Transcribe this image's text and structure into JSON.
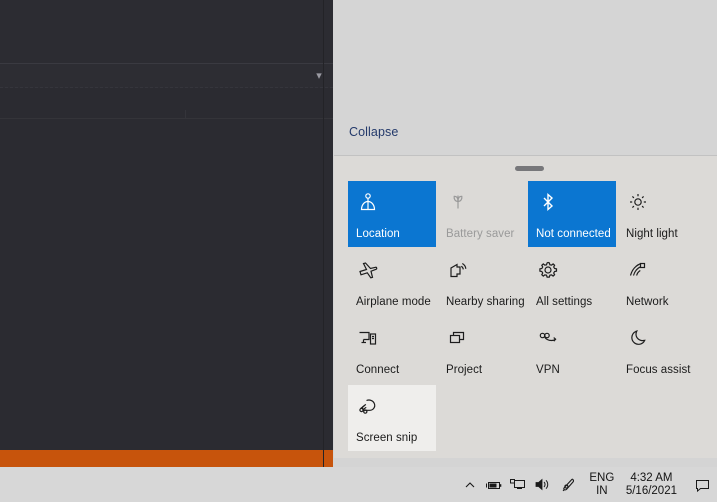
{
  "action_center": {
    "collapse_label": "Collapse",
    "handle_name": "resize-handle",
    "tiles": [
      {
        "label": "Location",
        "icon": "location-icon",
        "state": "on"
      },
      {
        "label": "Battery saver",
        "icon": "battery-saver-icon",
        "state": "disabled"
      },
      {
        "label": "Not connected",
        "icon": "bluetooth-icon",
        "state": "on"
      },
      {
        "label": "Night light",
        "icon": "night-light-icon",
        "state": "off"
      },
      {
        "label": "Airplane mode",
        "icon": "airplane-icon",
        "state": "off"
      },
      {
        "label": "Nearby sharing",
        "icon": "nearby-sharing-icon",
        "state": "off"
      },
      {
        "label": "All settings",
        "icon": "gear-icon",
        "state": "off"
      },
      {
        "label": "Network",
        "icon": "network-wifi-icon",
        "state": "off"
      },
      {
        "label": "Connect",
        "icon": "connect-icon",
        "state": "off"
      },
      {
        "label": "Project",
        "icon": "project-icon",
        "state": "off"
      },
      {
        "label": "VPN",
        "icon": "vpn-icon",
        "state": "off"
      },
      {
        "label": "Focus assist",
        "icon": "moon-icon",
        "state": "off"
      },
      {
        "label": "Screen snip",
        "icon": "screen-snip-icon",
        "state": "hover"
      }
    ]
  },
  "taskbar": {
    "tray_icons": [
      {
        "name": "show-hidden-icons-chevron-icon"
      },
      {
        "name": "battery-icon"
      },
      {
        "name": "network-ethernet-icon"
      },
      {
        "name": "volume-icon"
      },
      {
        "name": "pen-ink-workspace-icon"
      }
    ],
    "language": {
      "line1": "ENG",
      "line2": "IN"
    },
    "clock": {
      "time": "4:32 AM",
      "date": "5/16/2021"
    },
    "notification_icon": "action-center-notification-icon"
  },
  "colors": {
    "tile_accent": "#0b76d1",
    "panel_background": "#dcdad7",
    "panel_upper_background": "#d5d5d5",
    "app_accent_bar": "#c7540c",
    "app_background": "#2b2b31",
    "link": "#243a6b"
  }
}
